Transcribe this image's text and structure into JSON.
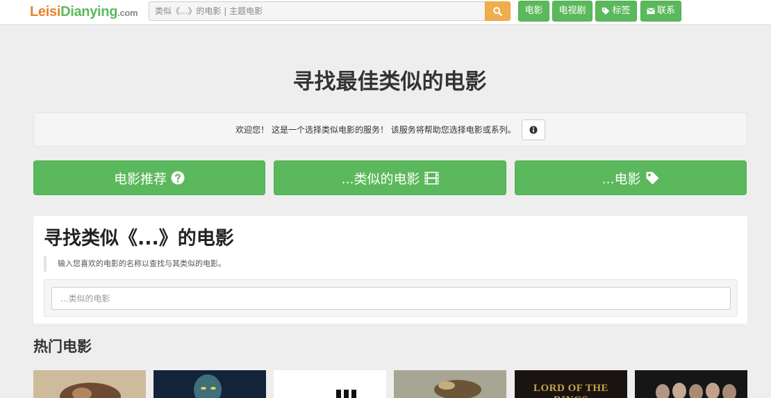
{
  "nav": {
    "logo": {
      "part1": "Leisi",
      "part2": "Dianying",
      "part3": ".com"
    },
    "search_placeholder": "类似《...》的电影 | 主题电影",
    "search_icon": "search-icon",
    "buttons": [
      {
        "label": "电影",
        "icon": ""
      },
      {
        "label": "电视剧",
        "icon": ""
      },
      {
        "label": "标签",
        "icon": "tag-icon"
      },
      {
        "label": "联系",
        "icon": "envelope-icon"
      }
    ]
  },
  "hero": {
    "title": "寻找最佳类似的电影",
    "welcome": "欢迎您！ 这是一个选择类似电影的服务！ 该服务将帮助您选择电影或系列。",
    "info_icon": "info-circle-icon"
  },
  "actions": [
    {
      "label": "电影推荐",
      "icon": "question-circle-icon"
    },
    {
      "label": "...类似的电影",
      "icon": "film-icon"
    },
    {
      "label": "...电影",
      "icon": "tag-icon"
    }
  ],
  "finder": {
    "title": "寻找类似《...》的电影",
    "hint": "输入您喜欢的电影的名称以查找与其类似的电影。",
    "input_placeholder": "...类似的电影"
  },
  "popular": {
    "title": "热门电影",
    "posters": [
      {
        "text": "",
        "bg": "#b49a7a"
      },
      {
        "text": "",
        "bg": "#1e3552"
      },
      {
        "text": "",
        "bg": "#ffffff"
      },
      {
        "text": "",
        "bg": "#8d8a78"
      },
      {
        "text": "LORD OF THE RINGS",
        "bg": "#1a1410"
      },
      {
        "text": "",
        "bg": "#161616"
      }
    ]
  },
  "colors": {
    "accent_green": "#5cb85c",
    "search_orange": "#f0ad4e",
    "logo_orange": "#e8832a",
    "background": "#eeeeee"
  }
}
